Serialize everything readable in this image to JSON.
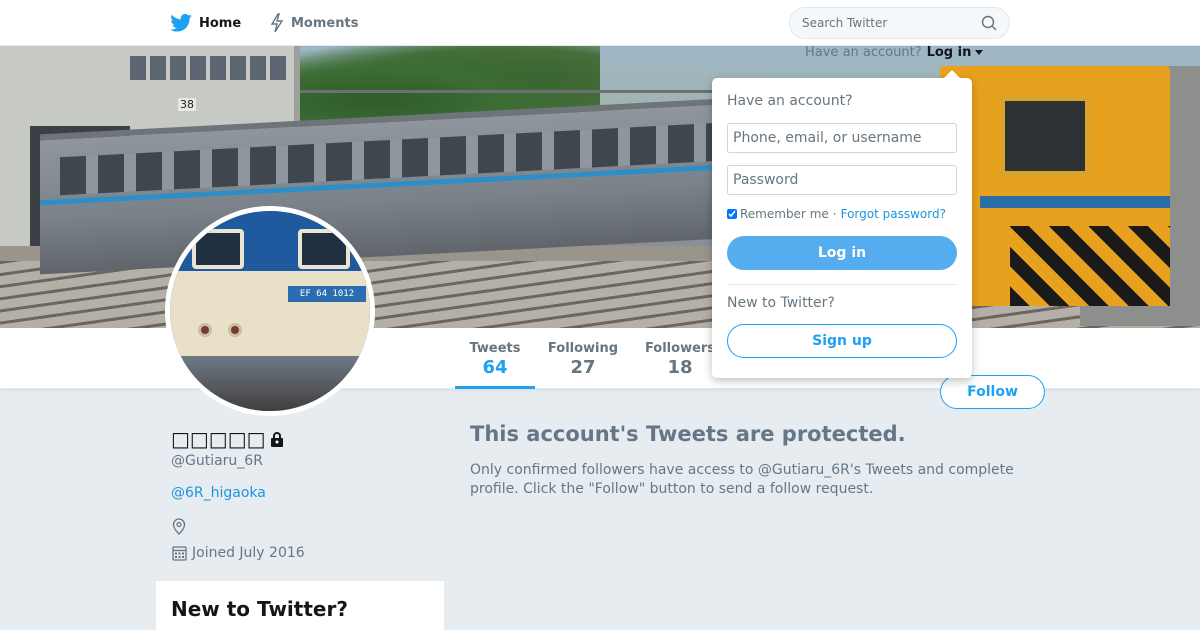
{
  "topbar": {
    "home_label": "Home",
    "moments_label": "Moments",
    "search_placeholder": "Search Twitter"
  },
  "login_hint": {
    "prompt": "Have an account?",
    "link": "Log in"
  },
  "login_dropdown": {
    "heading": "Have an account?",
    "username_placeholder": "Phone, email, or username",
    "password_placeholder": "Password",
    "remember_label": "Remember me",
    "separator": "·",
    "forgot_label": "Forgot password?",
    "login_button": "Log in",
    "new_heading": "New to Twitter?",
    "signup_button": "Sign up"
  },
  "header_image": {
    "building_number": "38"
  },
  "avatar": {
    "plate_text": "EF 64 1012"
  },
  "stats": [
    {
      "label": "Tweets",
      "value": "64"
    },
    {
      "label": "Following",
      "value": "27"
    },
    {
      "label": "Followers",
      "value": "18"
    }
  ],
  "follow_button": "Follow",
  "profile": {
    "name": "□□□□□",
    "handle": "@Gutiaru_6R",
    "bio_link": "@6R_higaoka",
    "joined": "Joined July 2016"
  },
  "protected": {
    "title": "This account's Tweets are protected.",
    "body": "Only confirmed followers have access to @Gutiaru_6R's Tweets and complete profile. Click the \"Follow\" button to send a follow request."
  },
  "sidebar_box": {
    "heading": "New to Twitter?"
  },
  "colors": {
    "accent": "#1da1f2",
    "login_button_bg": "#55acee",
    "background": "#e6ecf0",
    "muted_text": "#657786"
  },
  "icons": [
    "twitter-bird-icon",
    "lightning-icon",
    "search-icon",
    "lock-icon",
    "location-icon",
    "calendar-icon",
    "caret-down-icon"
  ]
}
